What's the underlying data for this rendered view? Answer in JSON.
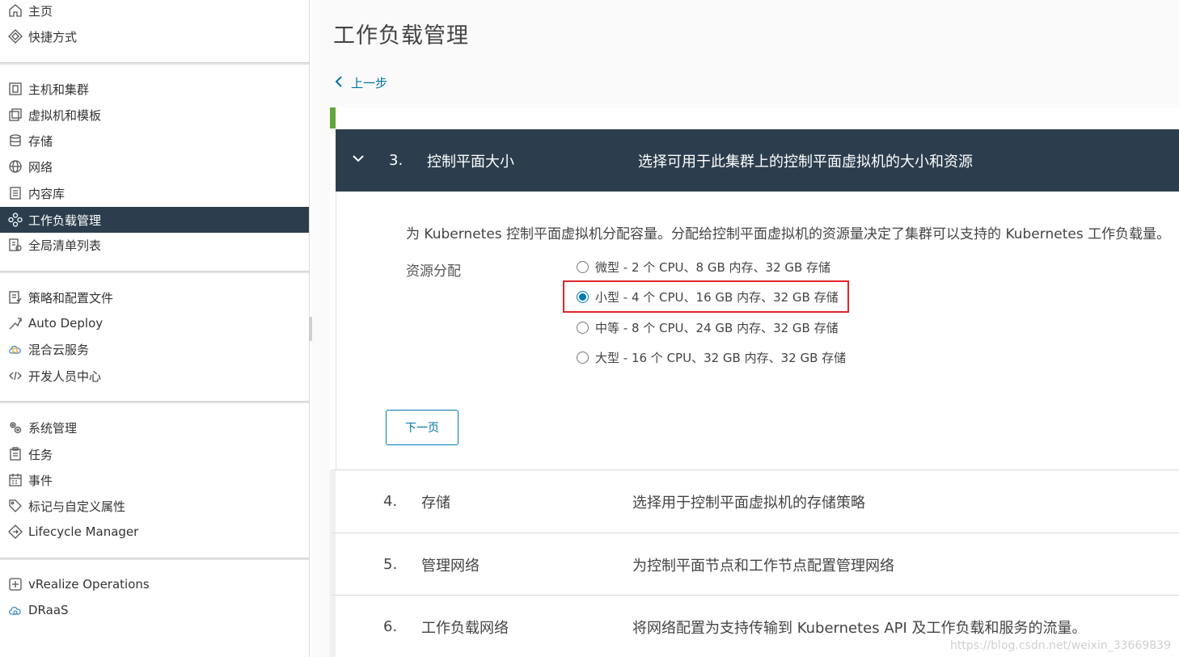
{
  "sidebar": {
    "items": [
      {
        "label": "主页",
        "icon": "home-icon"
      },
      {
        "label": "快捷方式",
        "icon": "shortcuts-icon"
      },
      {
        "label": "主机和集群",
        "icon": "hosts-clusters-icon"
      },
      {
        "label": "虚拟机和模板",
        "icon": "vm-templates-icon"
      },
      {
        "label": "存储",
        "icon": "storage-icon"
      },
      {
        "label": "网络",
        "icon": "network-icon"
      },
      {
        "label": "内容库",
        "icon": "content-library-icon"
      },
      {
        "label": "工作负载管理",
        "icon": "workload-management-icon",
        "active": true
      },
      {
        "label": "全局清单列表",
        "icon": "global-inventory-icon"
      },
      {
        "label": "策略和配置文件",
        "icon": "policies-profiles-icon"
      },
      {
        "label": "Auto Deploy",
        "icon": "auto-deploy-icon"
      },
      {
        "label": "混合云服务",
        "icon": "hybrid-cloud-icon"
      },
      {
        "label": "开发人员中心",
        "icon": "developer-center-icon"
      },
      {
        "label": "系统管理",
        "icon": "administration-icon"
      },
      {
        "label": "任务",
        "icon": "tasks-icon"
      },
      {
        "label": "事件",
        "icon": "events-icon"
      },
      {
        "label": "标记与自定义属性",
        "icon": "tags-icon"
      },
      {
        "label": "Lifecycle Manager",
        "icon": "lifecycle-icon"
      },
      {
        "label": "vRealize Operations",
        "icon": "vrops-icon"
      },
      {
        "label": "DRaaS",
        "icon": "draas-icon"
      }
    ]
  },
  "main": {
    "title": "工作负载管理",
    "back_label": "上一步",
    "active_step": {
      "number": "3.",
      "title": "控制平面大小",
      "description": "选择可用于此集群上的控制平面虚拟机的大小和资源",
      "body_text": "为 Kubernetes 控制平面虚拟机分配容量。分配给控制平面虚拟机的资源量决定了集群可以支持的 Kubernetes 工作负载量。",
      "field_label": "资源分配",
      "options": [
        {
          "label": "微型 - 2 个 CPU、8 GB 内存、32 GB 存储",
          "checked": false
        },
        {
          "label": "小型 - 4 个 CPU、16 GB 内存、32 GB 存储",
          "checked": true
        },
        {
          "label": "中等 - 8 个 CPU、24 GB 内存、32 GB 存储",
          "checked": false
        },
        {
          "label": "大型 - 16 个 CPU、32 GB 内存、32 GB 存储",
          "checked": false
        }
      ],
      "next_label": "下一页"
    },
    "steps": [
      {
        "number": "4.",
        "title": "存储",
        "description": "选择用于控制平面虚拟机的存储策略"
      },
      {
        "number": "5.",
        "title": "管理网络",
        "description": "为控制平面节点和工作节点配置管理网络"
      },
      {
        "number": "6.",
        "title": "工作负载网络",
        "description": "将网络配置为支持传输到 Kubernetes API 及工作负载和服务的流量。"
      }
    ]
  },
  "watermark": "https://blog.csdn.net/weixin_33669839",
  "colors": {
    "nav_active": "#2c3e4d",
    "accent": "#0079b8",
    "highlight": "#e0262b",
    "progress": "#61a73e"
  }
}
